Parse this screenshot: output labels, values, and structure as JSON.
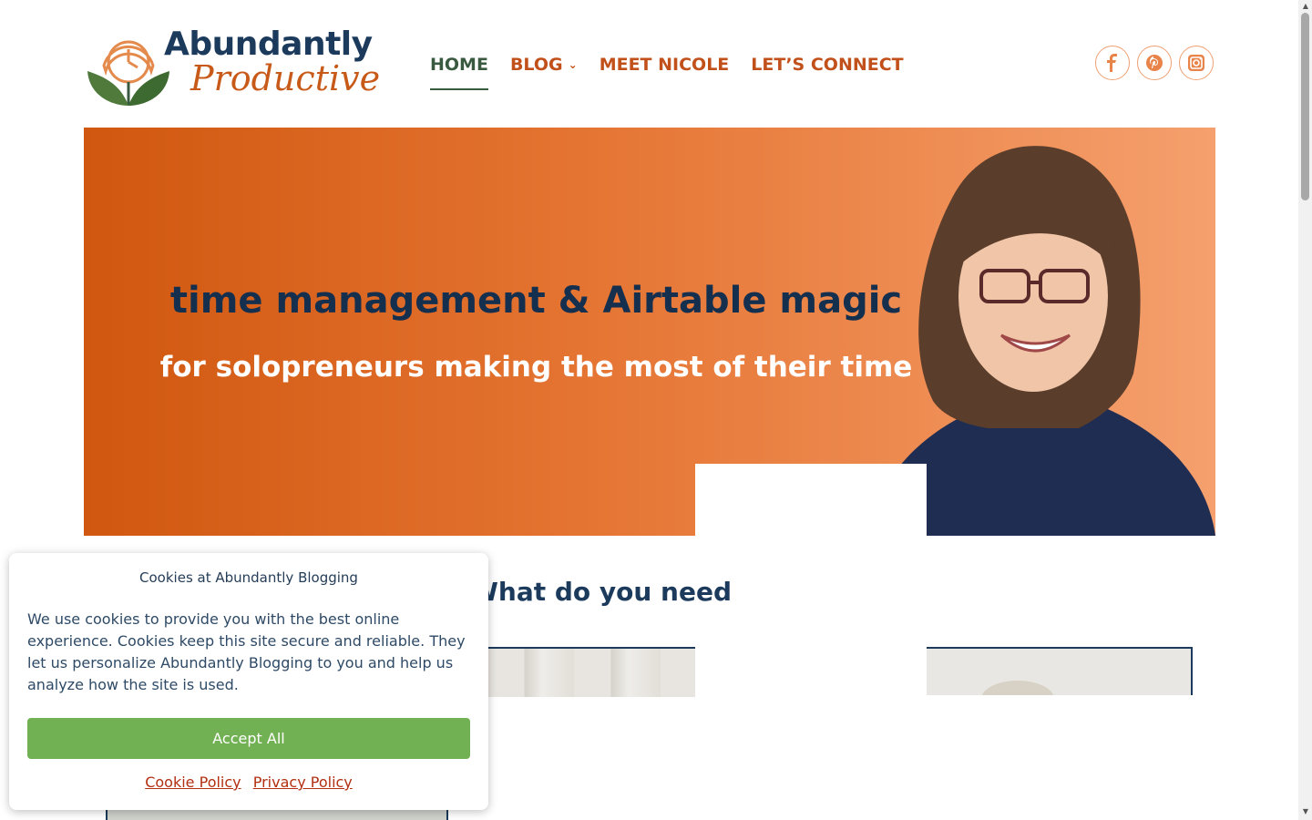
{
  "header": {
    "logo": {
      "line1": "Abundantly",
      "line2": "Productive"
    },
    "nav": [
      {
        "label": "HOME",
        "active": true
      },
      {
        "label": "BLOG",
        "has_dropdown": true
      },
      {
        "label": "MEET NICOLE"
      },
      {
        "label": "LET’S CONNECT"
      }
    ],
    "social": [
      "facebook-icon",
      "pinterest-icon",
      "instagram-icon"
    ]
  },
  "hero": {
    "title": "time management & Airtable magic",
    "subtitle": "for solopreneurs making the most of their time"
  },
  "section": {
    "heading": "What do you need"
  },
  "cookie_banner": {
    "title": "Cookies at Abundantly Blogging",
    "text": "We use cookies to provide you with the best online experience. Cookies keep this site secure and reliable. They let us personalize Abundantly Blogging to you and help us analyze how the site is used.",
    "accept_label": "Accept All",
    "cookie_policy_label": "Cookie Policy",
    "privacy_policy_label": "Privacy Policy"
  },
  "colors": {
    "brand_navy": "#1b3a5c",
    "brand_orange": "#c1501b",
    "brand_green": "#3a5a40",
    "accept_green": "#72b153"
  }
}
